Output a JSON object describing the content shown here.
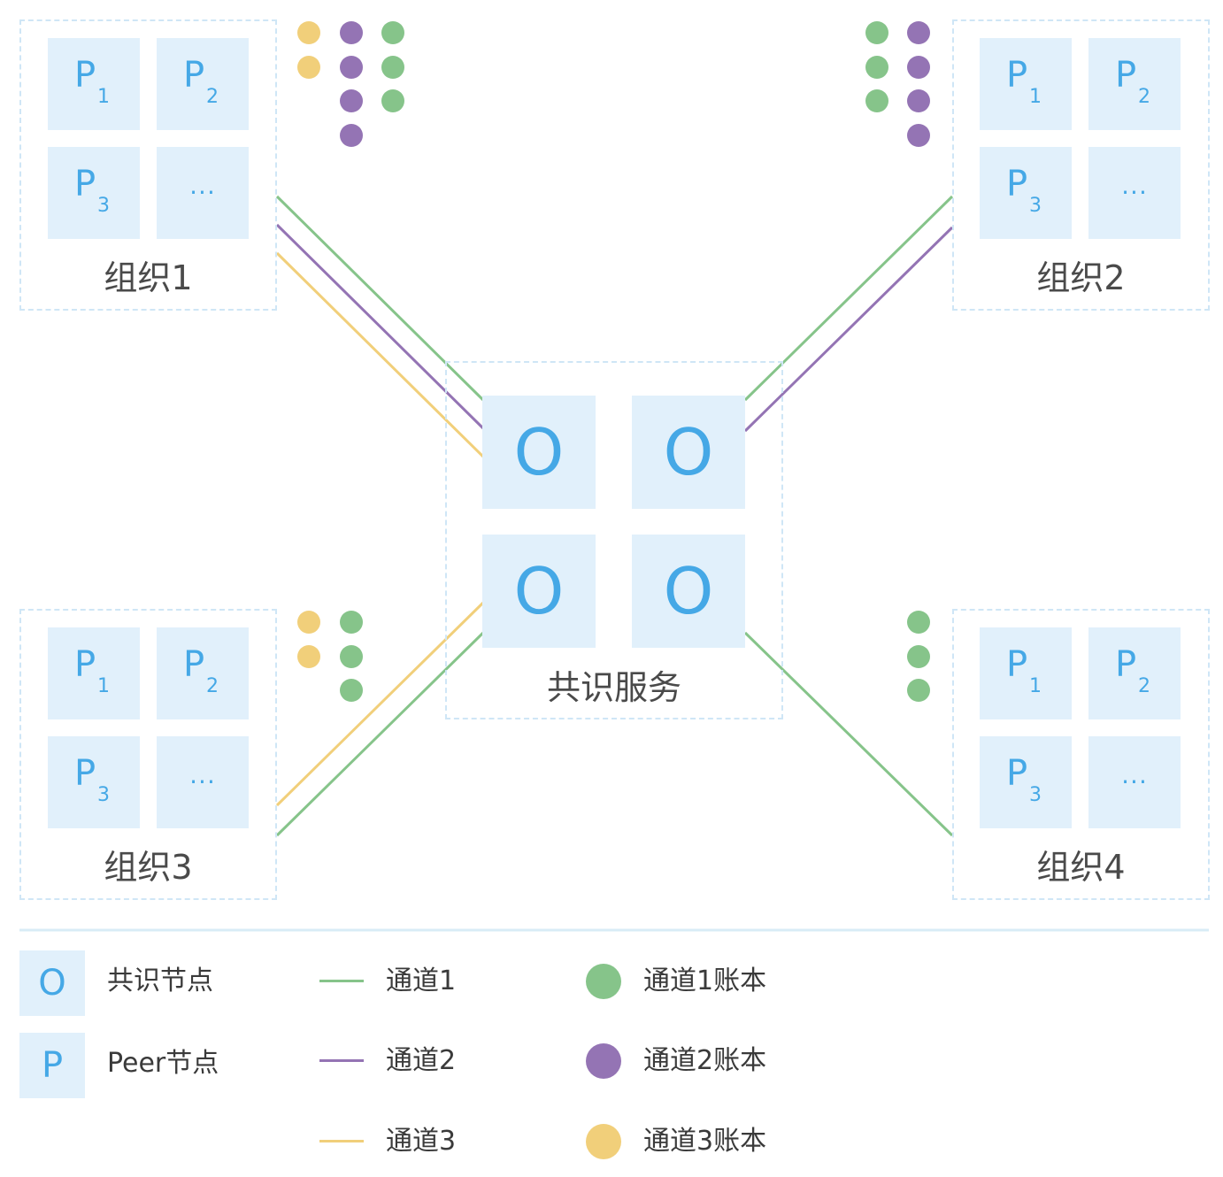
{
  "colors": {
    "channel1": "#86c48a",
    "channel2": "#9474b4",
    "channel3": "#f1cf7a",
    "node_bg": "#e1f0fb",
    "node_text": "#45a8e6",
    "dash_border": "#cfe6f6"
  },
  "peer_labels": {
    "p": "P",
    "sub1": "1",
    "sub2": "2",
    "sub3": "3",
    "more": "..."
  },
  "orgs": [
    {
      "label": "组织1"
    },
    {
      "label": "组织2"
    },
    {
      "label": "组织3"
    },
    {
      "label": "组织4"
    }
  ],
  "orderer": {
    "label": "共识服务",
    "node_symbol": "O"
  },
  "ledger_dots": {
    "org1": {
      "channel3": 2,
      "channel2": 4,
      "channel1": 3
    },
    "org2": {
      "channel1": 3,
      "channel2": 4
    },
    "org3": {
      "channel3": 2,
      "channel1": 3
    },
    "org4": {
      "channel1": 3
    }
  },
  "legend": {
    "orderer_symbol": "O",
    "orderer_label": "共识节点",
    "peer_symbol": "P",
    "peer_label": "Peer节点",
    "channel1": "通道1",
    "channel2": "通道2",
    "channel3": "通道3",
    "ledger1": "通道1账本",
    "ledger2": "通道2账本",
    "ledger3": "通道3账本"
  }
}
